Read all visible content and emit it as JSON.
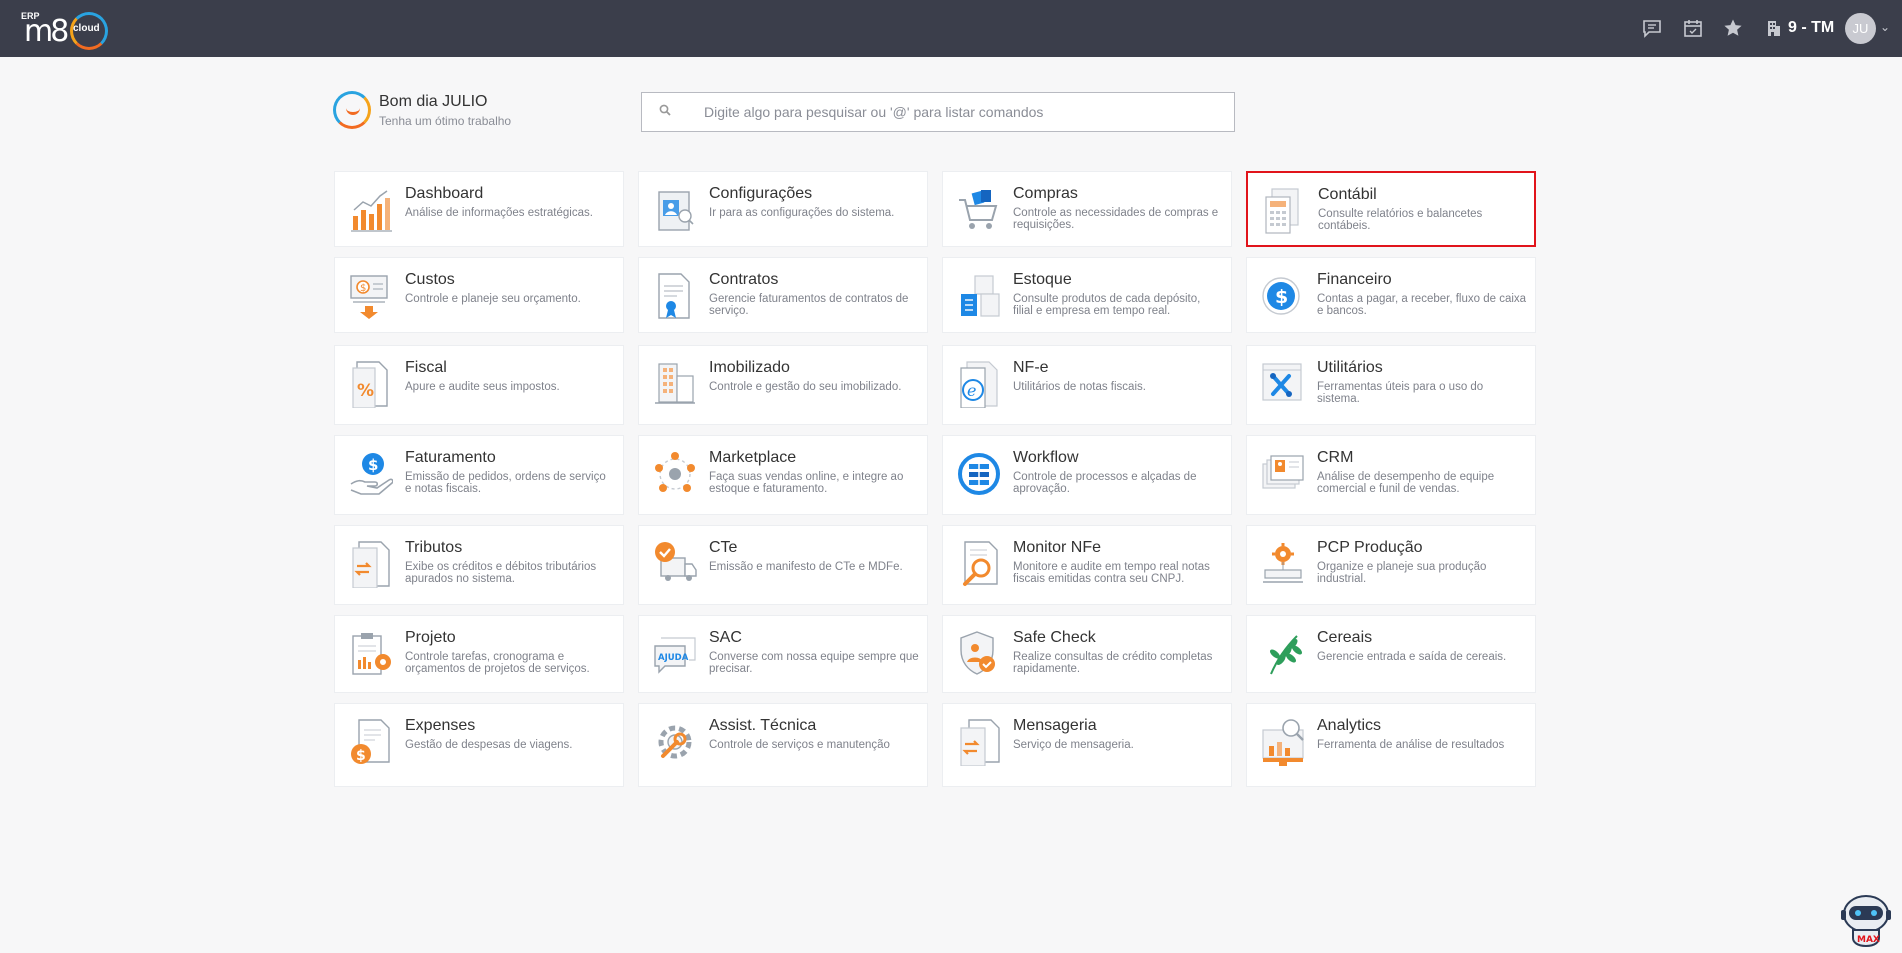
{
  "brand": {
    "erp": "ERP",
    "mark": "m8",
    "cloud": "cloud"
  },
  "topbar": {
    "company": "9 - TM",
    "avatar": "JU",
    "icons": [
      "chat-icon",
      "calendar-icon",
      "star-icon",
      "building-icon"
    ]
  },
  "greeting": {
    "title": "Bom dia JULIO",
    "subtitle": "Tenha um ótimo trabalho"
  },
  "search": {
    "placeholder": "Digite algo para pesquisar ou '@' para listar comandos",
    "value": ""
  },
  "colors": {
    "topbar": "#3b3e4b",
    "orange": "#f28a2e",
    "blue": "#1e88e5",
    "highlight": "#e1141b"
  },
  "modules": [
    {
      "id": "dashboard",
      "title": "Dashboard",
      "desc": "Análise de informações estratégicas.",
      "icon": "bar-chart-icon"
    },
    {
      "id": "configuracoes",
      "title": "Configurações",
      "desc": "Ir para as configurações do sistema.",
      "icon": "settings-icon"
    },
    {
      "id": "compras",
      "title": "Compras",
      "desc": "Controle as necessidades de compras e requisições.",
      "icon": "cart-icon"
    },
    {
      "id": "contabil",
      "title": "Contábil",
      "desc": "Consulte relatórios e balancetes contábeis.",
      "icon": "calculator-icon",
      "highlight": true
    },
    {
      "id": "custos",
      "title": "Custos",
      "desc": "Controle e planeje seu orçamento.",
      "icon": "money-icon"
    },
    {
      "id": "contratos",
      "title": "Contratos",
      "desc": "Gerencie faturamentos de contratos de serviço.",
      "icon": "contract-icon"
    },
    {
      "id": "estoque",
      "title": "Estoque",
      "desc": "Consulte produtos de cada depósito, filial e empresa em tempo real.",
      "icon": "boxes-icon"
    },
    {
      "id": "financeiro",
      "title": "Financeiro",
      "desc": "Contas a pagar, a receber, fluxo de caixa e bancos.",
      "icon": "dollar-icon"
    },
    {
      "id": "fiscal",
      "title": "Fiscal",
      "desc": "Apure e audite seus impostos.",
      "icon": "percent-icon"
    },
    {
      "id": "imobilizado",
      "title": "Imobilizado",
      "desc": "Controle e gestão do seu imobilizado.",
      "icon": "building-icon"
    },
    {
      "id": "nfe",
      "title": "NF-e",
      "desc": "Utilitários de notas fiscais.",
      "icon": "nfe-icon"
    },
    {
      "id": "utilitarios",
      "title": "Utilitários",
      "desc": "Ferramentas úteis para o uso do sistema.",
      "icon": "tools-icon"
    },
    {
      "id": "faturamento",
      "title": "Faturamento",
      "desc": "Emissão de pedidos, ordens de serviço e notas fiscais.",
      "icon": "hand-dollar-icon"
    },
    {
      "id": "marketplace",
      "title": "Marketplace",
      "desc": "Faça suas vendas online, e integre ao estoque e faturamento.",
      "icon": "network-icon"
    },
    {
      "id": "workflow",
      "title": "Workflow",
      "desc": "Controle de processos e alçadas de aprovação.",
      "icon": "workflow-icon"
    },
    {
      "id": "crm",
      "title": "CRM",
      "desc": "Análise de desempenho de equipe comercial e funil de vendas.",
      "icon": "crm-icon"
    },
    {
      "id": "tributos",
      "title": "Tributos",
      "desc": "Exibe os créditos e débitos tributários apurados no sistema.",
      "icon": "exchange-doc-icon"
    },
    {
      "id": "cte",
      "title": "CTe",
      "desc": "Emissão e manifesto de CTe e MDFe.",
      "icon": "truck-icon"
    },
    {
      "id": "monitor_nfe",
      "title": "Monitor NFe",
      "desc": "Monitore e audite em tempo real notas fiscais emitidas contra seu CNPJ.",
      "icon": "magnifier-doc-icon"
    },
    {
      "id": "pcp",
      "title": "PCP Produção",
      "desc": "Organize e planeje sua produção industrial.",
      "icon": "gear-factory-icon"
    },
    {
      "id": "projeto",
      "title": "Projeto",
      "desc": "Controle tarefas, cronograma e orçamentos de projetos de serviços.",
      "icon": "clipboard-gear-icon"
    },
    {
      "id": "sac",
      "title": "SAC",
      "desc": "Converse com nossa equipe sempre que precisar.",
      "icon": "help-chat-icon",
      "badge": "AJUDA"
    },
    {
      "id": "safecheck",
      "title": "Safe Check",
      "desc": "Realize consultas de crédito completas rapidamente.",
      "icon": "shield-check-icon"
    },
    {
      "id": "cereais",
      "title": "Cereais",
      "desc": "Gerencie entrada e saída de cereais.",
      "icon": "wheat-icon"
    },
    {
      "id": "expenses",
      "title": "Expenses",
      "desc": "Gestão de despesas de viagens.",
      "icon": "expense-doc-icon"
    },
    {
      "id": "assist",
      "title": "Assist. Técnica",
      "desc": "Controle de serviços e manutenção",
      "icon": "wrench-gear-icon"
    },
    {
      "id": "mensageria",
      "title": "Mensageria",
      "desc": "Serviço de mensageria.",
      "icon": "message-doc-icon"
    },
    {
      "id": "analytics",
      "title": "Analytics",
      "desc": "Ferramenta de análise de resultados",
      "icon": "analytics-icon"
    }
  ],
  "bot": {
    "label": "MAX"
  }
}
